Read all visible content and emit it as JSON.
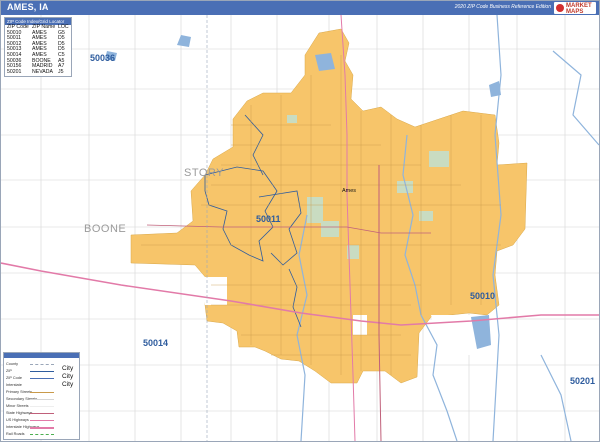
{
  "header": {
    "title": "AMES, IA",
    "edition": "2020 ZIP Code Business Reference Edition",
    "brand": "MARKET MAPS"
  },
  "zip_index": {
    "header": "ZIP Code Index/Grid Locator",
    "columns": [
      "ZIP Code",
      "ZIP Name",
      "LOC"
    ],
    "rows": [
      [
        "50010",
        "AMES",
        "G5"
      ],
      [
        "50011",
        "AMES",
        "D5"
      ],
      [
        "50012",
        "AMES",
        "D5"
      ],
      [
        "50013",
        "AMES",
        "D5"
      ],
      [
        "50014",
        "AMES",
        "C5"
      ],
      [
        "50036",
        "BOONE",
        "A5"
      ],
      [
        "50156",
        "MADRID",
        "A7"
      ],
      [
        "50201",
        "NEVADA",
        "J5"
      ]
    ]
  },
  "map_labels": {
    "zip_50036": "50036",
    "zip_50011": "50011",
    "zip_50010": "50010",
    "zip_50014": "50014",
    "zip_50201": "50201",
    "story": "STORY",
    "boone": "BOONE",
    "ames": "Ames"
  },
  "legend": {
    "items": [
      "County",
      "ZIP",
      "ZIP Code",
      "Interstate",
      "Primary Streets",
      "Secondary Streets",
      "Minor Streets",
      "State Highways",
      "US Highways",
      "Interstate Highways",
      "Rail Roads"
    ],
    "city_labels": [
      "City",
      "City",
      "City"
    ]
  },
  "colors": {
    "title_bar": "#4a6fb5",
    "city_fill": "#f7c56a",
    "water": "#8fb4dc",
    "interstate": "#e27aa8",
    "zip_boundary": "#2e5c9e",
    "park": "#c9dcc1"
  }
}
